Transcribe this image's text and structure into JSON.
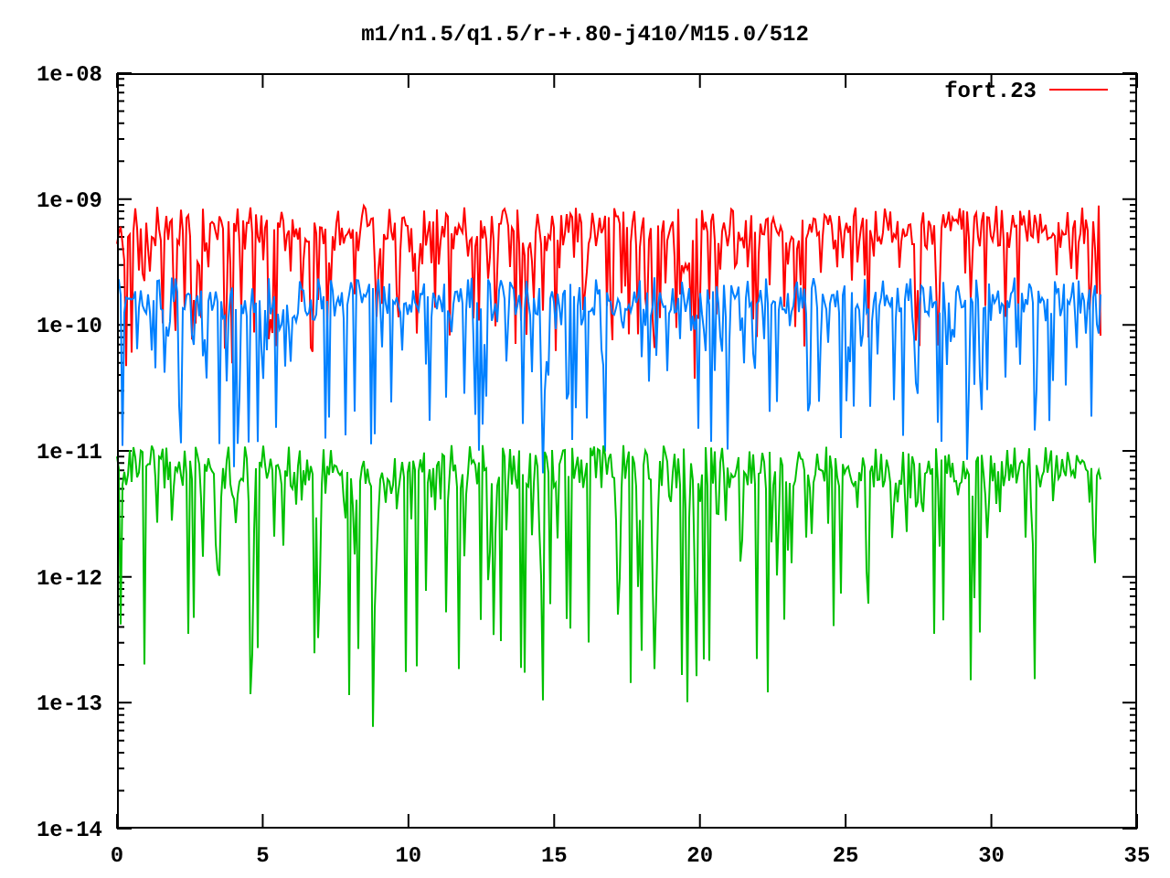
{
  "plot": {
    "title": "m1/n1.5/q1.5/r-+.80-j410/M15.0/512",
    "y_tick_labels": [
      "1e-08",
      "1e-09",
      "1e-10",
      "1e-11",
      "1e-12",
      "1e-13",
      "1e-14"
    ],
    "x_tick_labels": [
      "0",
      "5",
      "10",
      "15",
      "20",
      "25",
      "30",
      "35"
    ],
    "legend": [
      {
        "label": "fort.23",
        "color": "#ff0000"
      }
    ]
  }
}
